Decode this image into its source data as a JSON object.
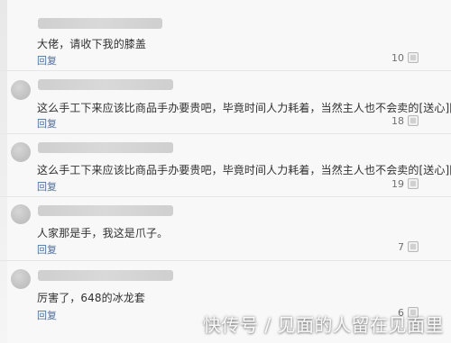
{
  "comments": [
    {
      "text": "大佬，请收下我的膝盖",
      "reply_label": "回复",
      "likes": "10"
    },
    {
      "text": "这么手工下来应该比商品手办要贵吧，毕竟时间人力耗着，当然主人也不会卖的[送心][送心][送心]",
      "reply_label": "回复",
      "likes": "18"
    },
    {
      "text": "这么手工下来应该比商品手办要贵吧，毕竟时间人力耗着，当然主人也不会卖的[送心][送心][送心]",
      "reply_label": "回复",
      "likes": "19"
    },
    {
      "text": "人家那是手，我这是爪子。",
      "reply_label": "回复",
      "likes": "7"
    },
    {
      "text": "厉害了，648的冰龙套",
      "reply_label": "回复",
      "likes": "6"
    }
  ],
  "watermark": "快传号 / 见面的人留在见面里",
  "colors": {
    "background": "#f8f8f8",
    "text": "#303030",
    "reply": "#4f6f9a",
    "likes": "#707070",
    "divider": "#e6e6e6"
  },
  "icons": {
    "like": "like-icon",
    "avatar": "avatar"
  }
}
